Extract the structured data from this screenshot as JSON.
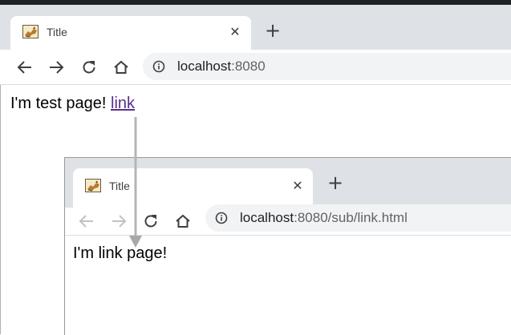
{
  "main_window": {
    "tab": {
      "title": "Title",
      "close_glyph": "✕"
    },
    "new_tab_glyph": "+",
    "address": {
      "host": "localhost",
      "rest": ":8080"
    },
    "page": {
      "text": "I'm test page! ",
      "link_text": "link"
    }
  },
  "popup_window": {
    "tab": {
      "title": "Title",
      "close_glyph": "✕"
    },
    "new_tab_glyph": "+",
    "address": {
      "host": "localhost",
      "rest": ":8080/sub/link.html"
    },
    "page": {
      "text": "I'm link page!"
    }
  },
  "icons": [
    "tomcat-favicon-icon",
    "back-arrow-icon",
    "forward-arrow-icon",
    "reload-icon",
    "home-icon",
    "info-icon",
    "close-icon",
    "plus-icon"
  ],
  "colors": {
    "tabbar": "#dee1e6",
    "omnibox": "#f1f3f4",
    "link": "#5a2f8c",
    "arrow": "#b5b5b5"
  }
}
